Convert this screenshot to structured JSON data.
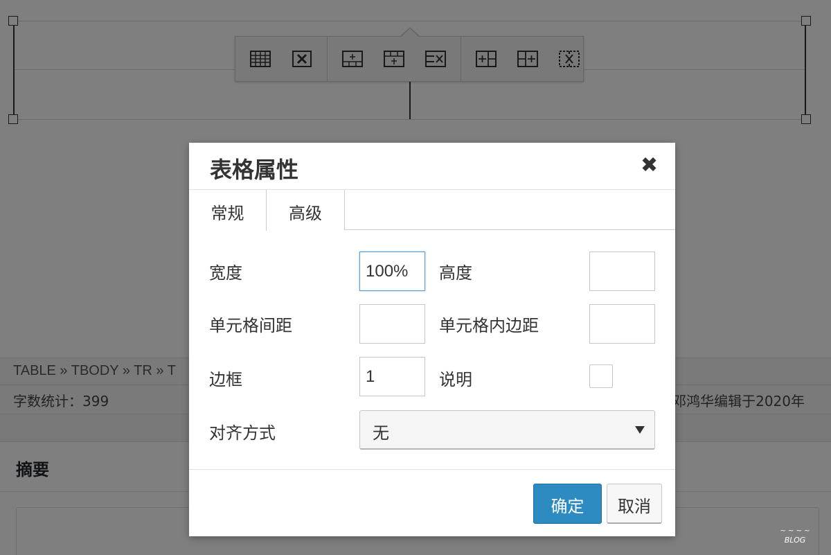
{
  "editor": {
    "breadcrumb": "TABLE » TBODY » TR » T",
    "word_count": "字数统计：399",
    "edited_by": "| 邓鸿华编辑于2020年",
    "summary_title": "摘要"
  },
  "table_toolbar": {
    "buttons": [
      "table-props",
      "delete-table",
      "insert-row-before",
      "insert-row-after",
      "delete-row",
      "insert-col-before",
      "insert-col-after",
      "delete-col"
    ]
  },
  "dialog": {
    "title": "表格属性",
    "close_glyph": "✖",
    "tabs": [
      {
        "label": "常规",
        "active": true
      },
      {
        "label": "高级",
        "active": false
      }
    ],
    "fields": {
      "width_label": "宽度",
      "width_value": "100%",
      "height_label": "高度",
      "height_value": "",
      "cellspacing_label": "单元格间距",
      "cellspacing_value": "",
      "cellpadding_label": "单元格内边距",
      "cellpadding_value": "",
      "border_label": "边框",
      "border_value": "1",
      "caption_label": "说明",
      "caption_checked": false,
      "align_label": "对齐方式",
      "align_value": "无"
    },
    "ok_label": "确定",
    "cancel_label": "取消"
  },
  "colors": {
    "primary": "#2e8bc2",
    "overlay": "rgba(0,0,0,0.5)"
  },
  "watermark": "BLOG"
}
